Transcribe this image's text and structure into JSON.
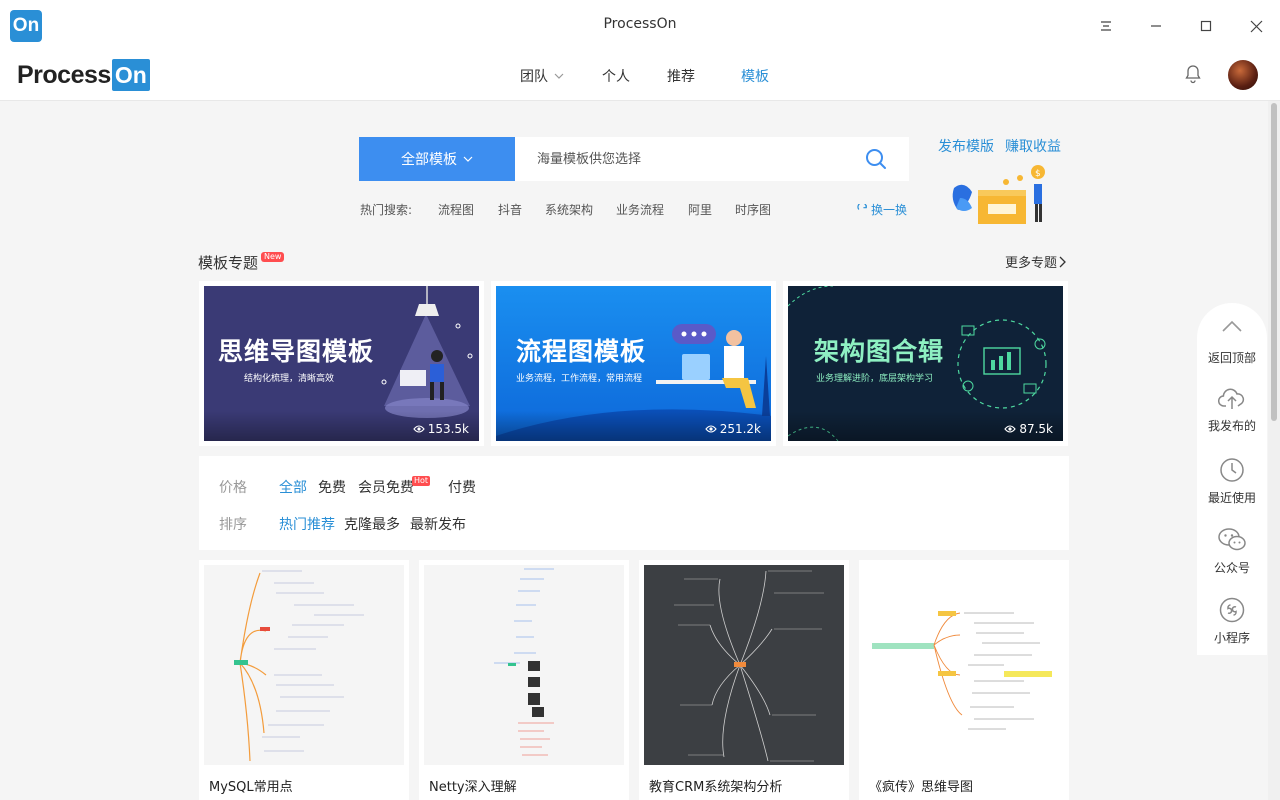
{
  "window": {
    "title": "ProcessOn",
    "app_icon_text": "On"
  },
  "logo": {
    "part1": "Process",
    "part2": "On"
  },
  "nav": {
    "items": [
      {
        "label": "团队",
        "has_dropdown": true,
        "active": false
      },
      {
        "label": "个人",
        "has_dropdown": false,
        "active": false
      },
      {
        "label": "推荐",
        "has_dropdown": false,
        "active": false
      },
      {
        "label": "模板",
        "has_dropdown": false,
        "active": true
      }
    ]
  },
  "search": {
    "category": "全部模板",
    "placeholder": "海量模板供您选择",
    "hot_label": "热门搜索:",
    "hot_terms": [
      "流程图",
      "抖音",
      "系统架构",
      "业务流程",
      "阿里",
      "时序图"
    ],
    "refresh_label": "换一换"
  },
  "promo": {
    "publish": "发布模版",
    "earn": "赚取收益"
  },
  "topics": {
    "title": "模板专题",
    "new_badge": "New",
    "more": "更多专题",
    "banners": [
      {
        "title": "思维导图模板",
        "subtitle": "结构化梳理，清晰高效",
        "views": "153.5k"
      },
      {
        "title": "流程图模板",
        "subtitle": "业务流程，工作流程，常用流程",
        "views": "251.2k"
      },
      {
        "title": "架构图合辑",
        "subtitle": "业务理解进阶，底层架构学习",
        "views": "87.5k"
      }
    ]
  },
  "filters": {
    "price_label": "价格",
    "price_options": [
      {
        "label": "全部",
        "active": true
      },
      {
        "label": "免费",
        "active": false
      },
      {
        "label": "会员免费",
        "active": false,
        "badge": "Hot"
      },
      {
        "label": "付费",
        "active": false
      }
    ],
    "sort_label": "排序",
    "sort_options": [
      {
        "label": "热门推荐",
        "active": true
      },
      {
        "label": "克隆最多",
        "active": false
      },
      {
        "label": "最新发布",
        "active": false
      }
    ]
  },
  "templates": [
    {
      "title": "MySQL常用点"
    },
    {
      "title": "Netty深入理解"
    },
    {
      "title": "教育CRM系统架构分析"
    },
    {
      "title": "《疯传》思维导图"
    }
  ],
  "float_panel": {
    "items": [
      {
        "label": "返回顶部",
        "icon": "chevron-up-icon"
      },
      {
        "label": "我发布的",
        "icon": "cloud-upload-icon"
      },
      {
        "label": "最近使用",
        "icon": "clock-icon"
      },
      {
        "label": "公众号",
        "icon": "wechat-icon"
      },
      {
        "label": "小程序",
        "icon": "mini-program-icon"
      }
    ]
  },
  "colors": {
    "accent": "#2a8fd6",
    "search_button": "#3d8ef0",
    "badge": "#ff4d4f"
  }
}
